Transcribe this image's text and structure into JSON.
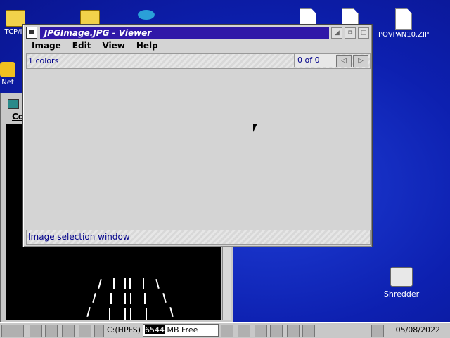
{
  "desktop": {
    "icons_top": [
      {
        "label": "TCP/IP"
      },
      {
        "label": ""
      },
      {
        "label": ""
      },
      {
        "label": ""
      },
      {
        "label": ""
      },
      {
        "label": ""
      },
      {
        "label": "POVPAN10.ZIP"
      }
    ],
    "net_label": "Net",
    "shredder_label": "Shredder"
  },
  "background_window": {
    "menu_fragment": "Co"
  },
  "viewer": {
    "title": "JPGImage.JPG - Viewer",
    "menu": [
      "Image",
      "Edit",
      "View",
      "Help"
    ],
    "colors_text": "1 colors",
    "count_text": "0 of 0",
    "status_text": "Image selection window"
  },
  "taskbar": {
    "drive_label": "C:(HPFS)",
    "free_value": "6544",
    "free_suffix": " MB Free",
    "date": "05/08/2022"
  }
}
